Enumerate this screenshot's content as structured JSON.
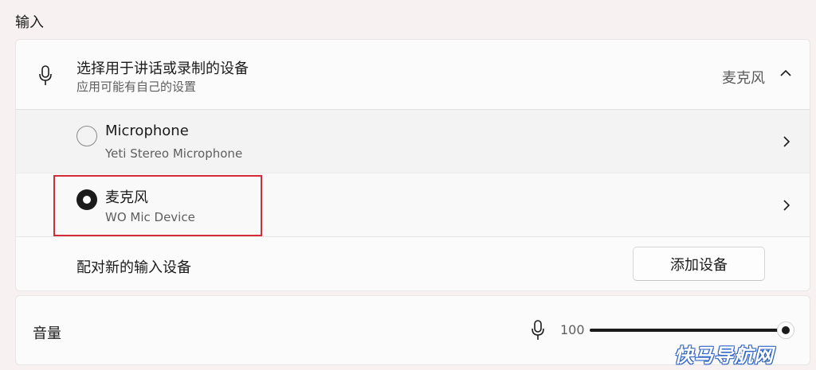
{
  "section": {
    "title": "输入"
  },
  "input_card": {
    "header": {
      "title": "选择用于讲话或录制的设备",
      "subtitle": "应用可能有自己的设置",
      "selected_value": "麦克风",
      "icon": "microphone-icon",
      "expanded": true
    },
    "devices": [
      {
        "name": "Microphone",
        "description": "Yeti Stereo Microphone",
        "selected": false
      },
      {
        "name": "麦克风",
        "description": "WO Mic Device",
        "selected": true
      }
    ],
    "pair": {
      "label": "配对新的输入设备",
      "button_label": "添加设备"
    }
  },
  "volume": {
    "label": "音量",
    "value": "100",
    "level_fraction": 1.0,
    "icon": "microphone-icon"
  },
  "watermark": {
    "text": "快马导航网"
  },
  "colors": {
    "highlight_border": "#d42b3a",
    "background": "#f7f1f1",
    "accent": "#1b1b1b"
  }
}
